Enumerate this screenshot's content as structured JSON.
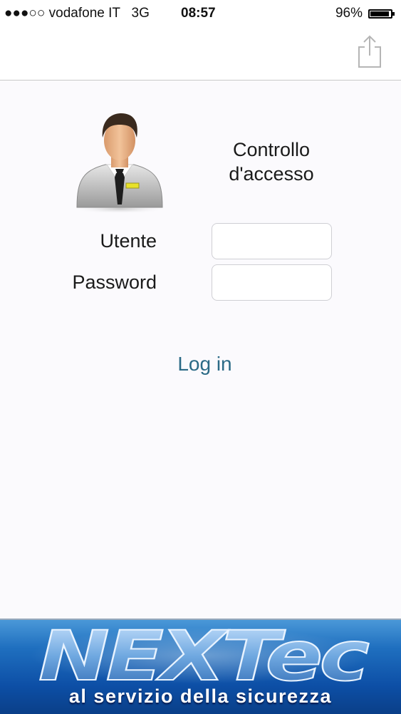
{
  "status_bar": {
    "signal": "●●●○○",
    "carrier": "vodafone IT",
    "network": "3G",
    "time": "08:57",
    "battery_percent": "96%",
    "battery_level": 0.96
  },
  "nav": {
    "share_icon": "share-icon"
  },
  "login_form": {
    "title_line1": "Controllo",
    "title_line2": "d'accesso",
    "user_label": "Utente",
    "user_value": "",
    "password_label": "Password",
    "password_value": "",
    "login_label": "Log in",
    "avatar_icon": "user-avatar-icon"
  },
  "banner": {
    "brand": "NEXTec",
    "tagline": "al servizio della sicurezza"
  },
  "colors": {
    "link": "#2b6a86",
    "banner_blue": "#0d4fa6",
    "background": "#fbfafd"
  }
}
